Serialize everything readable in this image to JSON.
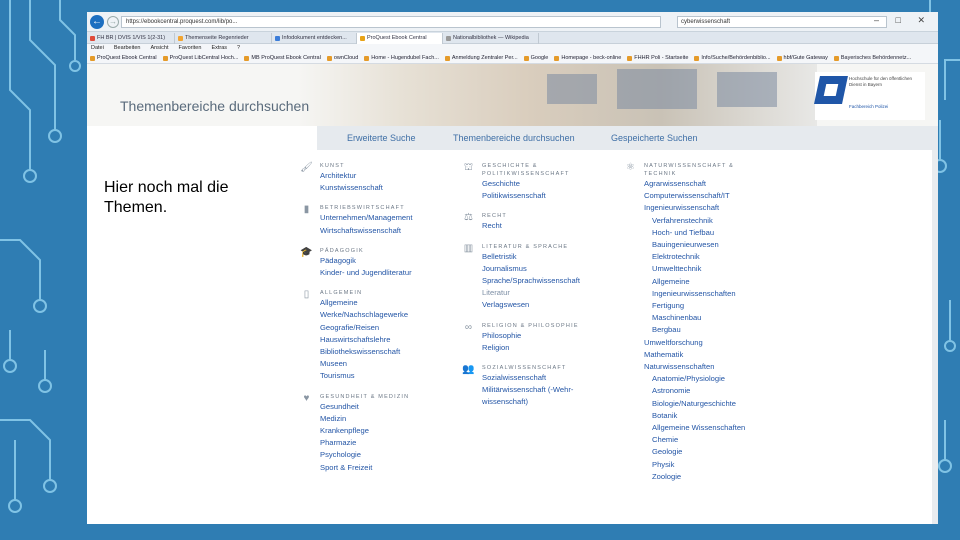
{
  "slide": {
    "caption": "Hier noch mal die Themen."
  },
  "browser": {
    "url": "https://ebookcentral.proquest.com/lib/po...",
    "search_text": "cyberwissenschaft",
    "window_controls": "– □ ✕",
    "tabs": [
      {
        "label": "FH BR | DVIS 1/VIS 1(2-31)",
        "color": "#e04b3a"
      },
      {
        "label": "Themenseite Regenrieder",
        "color": "#f2a531"
      },
      {
        "label": "Infodokument entdecken...",
        "color": "#3c7dd9"
      },
      {
        "label": "ProQuest Ebook Central",
        "color": "#e8a317"
      },
      {
        "label": "Nationalbibliothek — Wikipedia",
        "color": "#999999"
      }
    ],
    "menu": [
      "Datei",
      "Bearbeiten",
      "Ansicht",
      "Favoriten",
      "Extras",
      "?"
    ],
    "favorites": [
      "ProQuest Ebook Central",
      "ProQuest LibCentral Hoch...",
      "MB ProQuest Ebook Central",
      "ownCloud",
      "Home - Hugendubel Fach...",
      "Anmeldung Zentraler Per...",
      "Google",
      "Homepage - beck-online",
      "FHHR Poli - Startseite",
      "Info/Suche/Behördenbiblio...",
      "hbf/Gute Gateway",
      "Bayerisches Behördennetz..."
    ]
  },
  "banner": {
    "title": "Themenbereiche durchsuchen",
    "logo_text": "Hochschule für den öffentlichen Dienst in Bayern",
    "logo_sub": "Fachbereich Polizei"
  },
  "nav": {
    "items": [
      "Erweiterte Suche",
      "Themenbereiche durchsuchen",
      "Gespeicherte Suchen"
    ]
  },
  "columns": [
    [
      {
        "icon": "palette-icon",
        "glyph": "🖌",
        "title": "KUNST",
        "links": [
          {
            "t": "Architektur"
          },
          {
            "t": "Kunstwissenschaft"
          }
        ]
      },
      {
        "icon": "bar-chart-icon",
        "glyph": "▮",
        "title": "BETRIEBSWIRTSCHAFT",
        "links": [
          {
            "t": "Unternehmen/Management"
          },
          {
            "t": "Wirtschaftswissenschaft"
          }
        ]
      },
      {
        "icon": "graduation-icon",
        "glyph": "🎓",
        "title": "PÄDAGOGIK",
        "links": [
          {
            "t": "Pädagogik"
          },
          {
            "t": "Kinder- und Jugendliteratur"
          }
        ]
      },
      {
        "icon": "book-icon",
        "glyph": "▯",
        "title": "ALLGEMEIN",
        "links": [
          {
            "t": "Allgemeine"
          },
          {
            "t": "Werke/Nachschlagewerke"
          },
          {
            "t": "Geografie/Reisen"
          },
          {
            "t": "Hauswirtschaftslehre"
          },
          {
            "t": "Bibliothekswissenschaft"
          },
          {
            "t": "Museen"
          },
          {
            "t": "Tourismus"
          }
        ]
      },
      {
        "icon": "heart-icon",
        "glyph": "♥",
        "title": "GESUNDHEIT & MEDIZIN",
        "links": [
          {
            "t": "Gesundheit"
          },
          {
            "t": "Medizin"
          },
          {
            "t": "Krankenpflege"
          },
          {
            "t": "Pharmazie"
          },
          {
            "t": "Psychologie"
          },
          {
            "t": "Sport & Freizeit"
          }
        ]
      }
    ],
    [
      {
        "icon": "museum-icon",
        "glyph": "⛫",
        "title": "GESCHICHTE & POLITIKWISSENSCHAFT",
        "links": [
          {
            "t": "Geschichte"
          },
          {
            "t": "Politikwissenschaft"
          }
        ]
      },
      {
        "icon": "scales-icon",
        "glyph": "⚖",
        "title": "RECHT",
        "links": [
          {
            "t": "Recht"
          }
        ]
      },
      {
        "icon": "books-icon",
        "glyph": "▥",
        "title": "LITERATUR & SPRACHE",
        "links": [
          {
            "t": "Belletristik"
          },
          {
            "t": "Journalismus"
          },
          {
            "t": "Sprache/Sprachwissenschaft"
          },
          {
            "t": "Literatur",
            "grey": true
          },
          {
            "t": "Verlagswesen"
          }
        ]
      },
      {
        "icon": "infinity-icon",
        "glyph": "∞",
        "title": "RELIGION & PHILOSOPHIE",
        "links": [
          {
            "t": "Philosophie"
          },
          {
            "t": "Religion"
          }
        ]
      },
      {
        "icon": "people-icon",
        "glyph": "👥",
        "title": "SOZIALWISSENSCHAFT",
        "links": [
          {
            "t": "Sozialwissenschaft"
          },
          {
            "t": "Militärwissenschaft (-Wehr-"
          },
          {
            "t": "wissenschaft)"
          }
        ]
      }
    ],
    [
      {
        "icon": "atom-icon",
        "glyph": "⚛",
        "title": "NATURWISSENSCHAFT & TECHNIK",
        "links": [
          {
            "t": "Agrarwissenschaft"
          },
          {
            "t": "Computerwissenschaft/IT"
          },
          {
            "t": "Ingenieurwissenschaft"
          },
          {
            "t": "Verfahrenstechnik",
            "indent": true
          },
          {
            "t": "Hoch- und Tiefbau",
            "indent": true
          },
          {
            "t": "Bauingenieurwesen",
            "indent": true
          },
          {
            "t": "Elektrotechnik",
            "indent": true
          },
          {
            "t": "Umwelttechnik",
            "indent": true
          },
          {
            "t": "Allgemeine",
            "indent": true
          },
          {
            "t": "Ingenieurwissenschaften",
            "indent": true
          },
          {
            "t": "Fertigung",
            "indent": true
          },
          {
            "t": "Maschinenbau",
            "indent": true
          },
          {
            "t": "Bergbau",
            "indent": true
          },
          {
            "t": "Umweltforschung"
          },
          {
            "t": "Mathematik"
          },
          {
            "t": "Naturwissenschaften"
          },
          {
            "t": "Anatomie/Physiologie",
            "indent": true
          },
          {
            "t": "Astronomie",
            "indent": true
          },
          {
            "t": "Biologie/Naturgeschichte",
            "indent": true
          },
          {
            "t": "Botanik",
            "indent": true
          },
          {
            "t": "Allgemeine Wissenschaften",
            "indent": true
          },
          {
            "t": "Chemie",
            "indent": true
          },
          {
            "t": "Geologie",
            "indent": true
          },
          {
            "t": "Physik",
            "indent": true
          },
          {
            "t": "Zoologie",
            "indent": true
          }
        ]
      }
    ]
  ]
}
